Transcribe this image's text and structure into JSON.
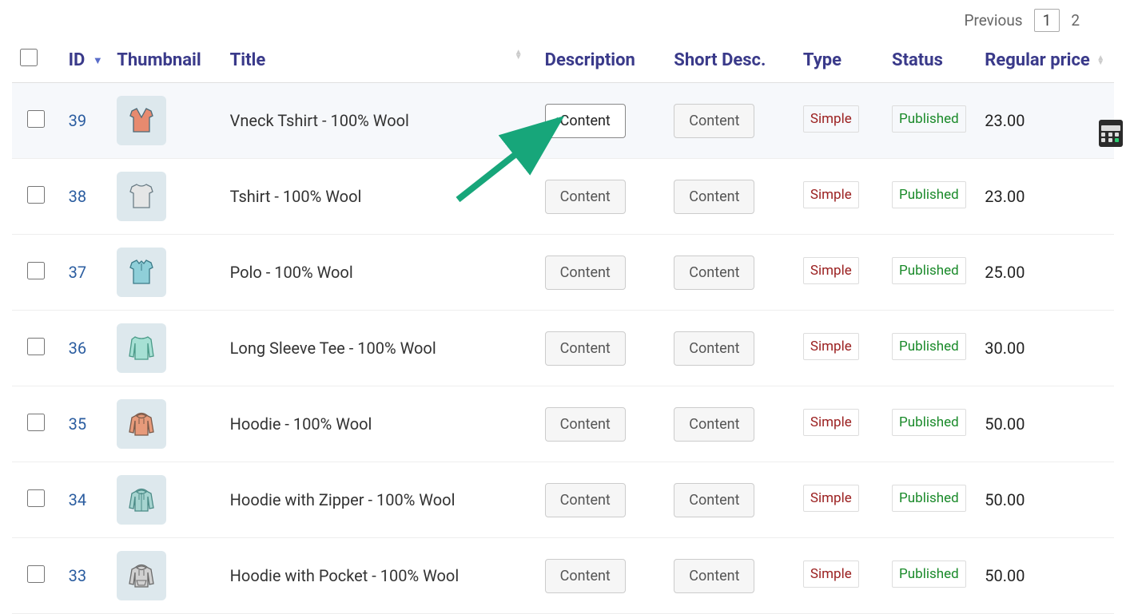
{
  "pagination": {
    "previous": "Previous",
    "current": "1",
    "next": "2"
  },
  "columns": {
    "id": "ID",
    "thumbnail": "Thumbnail",
    "title": "Title",
    "description": "Description",
    "short_desc": "Short Desc.",
    "type": "Type",
    "status": "Status",
    "regular_price": "Regular price"
  },
  "labels": {
    "content_button": "Content"
  },
  "rows": [
    {
      "id": "39",
      "title": "Vneck Tshirt - 100% Wool",
      "type": "Simple",
      "status": "Published",
      "price": "23.00",
      "thumb": "vneck",
      "highlight": true
    },
    {
      "id": "38",
      "title": "Tshirt - 100% Wool",
      "type": "Simple",
      "status": "Published",
      "price": "23.00",
      "thumb": "tshirt"
    },
    {
      "id": "37",
      "title": "Polo - 100% Wool",
      "type": "Simple",
      "status": "Published",
      "price": "25.00",
      "thumb": "polo"
    },
    {
      "id": "36",
      "title": "Long Sleeve Tee - 100% Wool",
      "type": "Simple",
      "status": "Published",
      "price": "30.00",
      "thumb": "longsleeve"
    },
    {
      "id": "35",
      "title": "Hoodie - 100% Wool",
      "type": "Simple",
      "status": "Published",
      "price": "50.00",
      "thumb": "hoodie"
    },
    {
      "id": "34",
      "title": "Hoodie with Zipper - 100% Wool",
      "type": "Simple",
      "status": "Published",
      "price": "50.00",
      "thumb": "hoodie-zip"
    },
    {
      "id": "33",
      "title": "Hoodie with Pocket - 100% Wool",
      "type": "Simple",
      "status": "Published",
      "price": "50.00",
      "thumb": "hoodie-pocket"
    }
  ],
  "thumb_colors": {
    "vneck": {
      "fill": "#e78a6f",
      "stroke": "#4a6a78"
    },
    "tshirt": {
      "fill": "#e5e6e6",
      "stroke": "#6b7d86"
    },
    "polo": {
      "fill": "#8fcfd9",
      "stroke": "#3b7a88"
    },
    "longsleeve": {
      "fill": "#a6e0d4",
      "stroke": "#4a9a88"
    },
    "hoodie": {
      "fill": "#e79a7a",
      "stroke": "#7a5a4a"
    },
    "hoodie-zip": {
      "fill": "#a6d4d0",
      "stroke": "#4a8a86"
    },
    "hoodie-pocket": {
      "fill": "#d0d0d0",
      "stroke": "#6a6a6a"
    }
  }
}
